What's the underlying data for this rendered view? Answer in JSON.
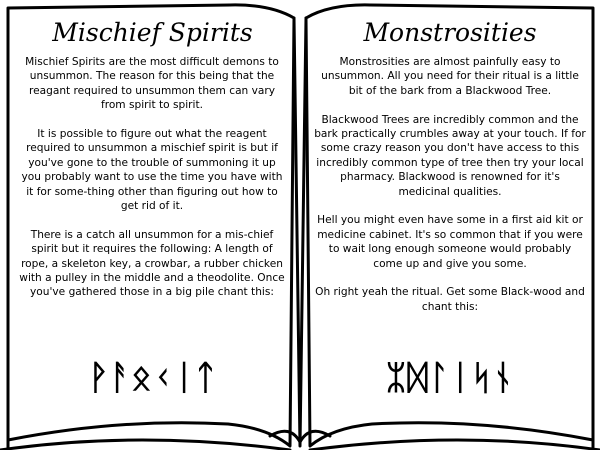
{
  "left_page": {
    "title": "Mischief Spirits",
    "paragraphs": [
      "Mischief Spirits are the most difficult demons to unsummon. The reason for this being that the reagant required to unsummon them can vary from spirit to spirit.",
      "It is possible to figure out what the reagent required to unsummon a mischief spirit is but if you've gone to the trouble of summoning it up you probably want to use the time you have with it for some-thing other than figuring out how to get rid of it.",
      "There is a catch all unsummon for a mis-chief spirit but it requires the following: A length of rope, a skeleton key, a crowbar, a rubber chicken with a pulley in the middle and a theodolite. Once you've gathered those in a big pile chant this:"
    ],
    "runes": "ᚹᚨᛟᚲᛁᛏ"
  },
  "right_page": {
    "title": "Monstrosities",
    "paragraphs": [
      "Monstrosities are almost painfully easy to unsummon. All you need for their ritual is a little bit of the bark from a Blackwood Tree.",
      "Blackwood Trees are incredibly common and the bark practically crumbles away at your touch. If for some crazy reason you don't have access to this incredibly common type of tree then try your local pharmacy. Blackwood is renowned for it's medicinal qualities.",
      "Hell you might even have some in a first aid kit or medicine cabinet. It's so common that if you were to wait long enough someone would probably come up and give you some.",
      "Oh right yeah the ritual. Get some Black-wood and chant this:"
    ],
    "runes": "ᛯᛞᛚᛁᛋᚾ"
  },
  "colors": {
    "ink": "#000000",
    "paper": "#ffffff"
  }
}
